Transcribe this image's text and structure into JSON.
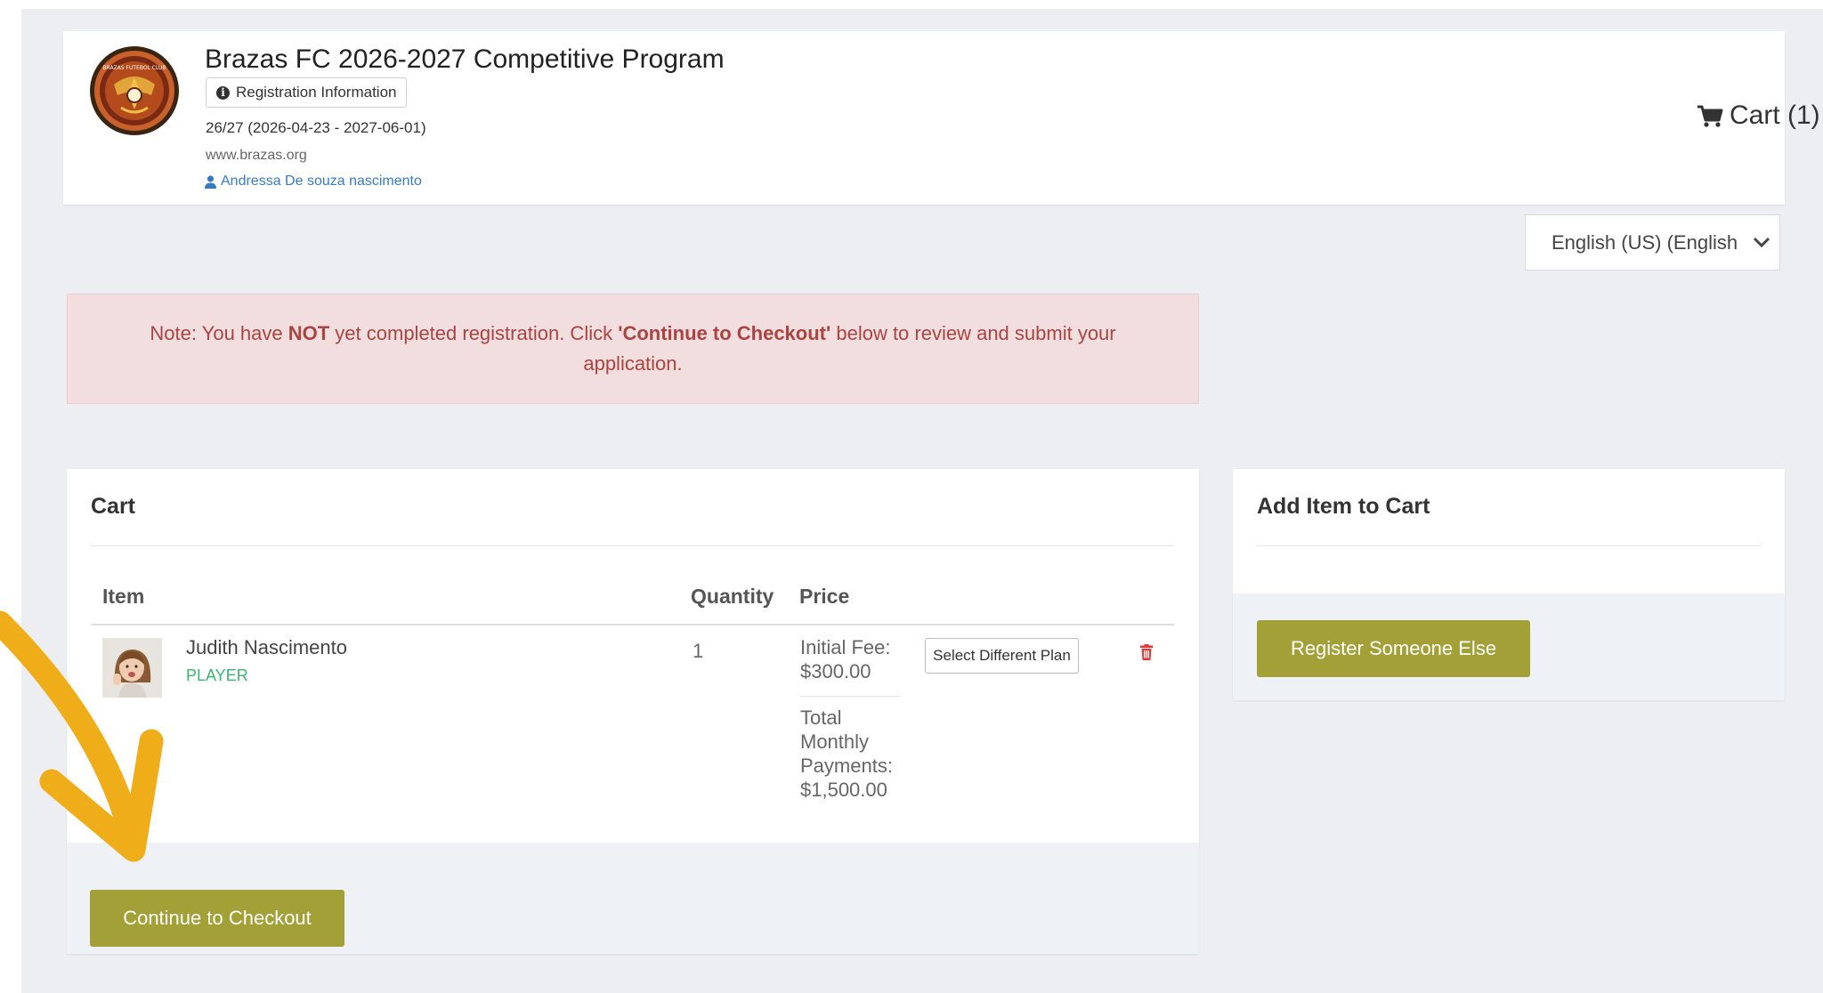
{
  "header": {
    "title": "Brazas FC 2026-2027 Competitive Program",
    "registration_info_label": "Registration Information",
    "season": "26/27 (2026-04-23 - 2027-06-01)",
    "website": "www.brazas.org",
    "user_name": "Andressa De souza nascimento",
    "cart_label": "Cart (1)",
    "logo_text": "BRAZAS FUTEBOL CLUB"
  },
  "language": {
    "selected": "English (US) (English"
  },
  "note": {
    "prefix": "Note: You have ",
    "emphasis": "NOT",
    "middle": " yet completed registration. Click ",
    "link": "'Continue to Checkout'",
    "suffix": " below to review and submit your application."
  },
  "cart": {
    "title": "Cart",
    "columns": {
      "item": "Item",
      "quantity": "Quantity",
      "price": "Price"
    },
    "items": [
      {
        "name": "Judith Nascimento",
        "role": "PLAYER",
        "quantity": "1",
        "initial_fee_label": "Initial Fee:",
        "initial_fee": "$300.00",
        "monthly_label": "Total Monthly Payments:",
        "monthly_total": "$1,500.00",
        "plan_button": "Select Different Plan"
      }
    ],
    "checkout_button": "Continue to Checkout"
  },
  "add_item": {
    "title": "Add Item to Cart",
    "register_button": "Register Someone Else"
  },
  "colors": {
    "olive_button": "#a3a038",
    "alert_bg": "#f2dede",
    "alert_text": "#a94442",
    "player_role": "#3cb371",
    "link_blue": "#3a7bc0",
    "annotation_arrow": "#f0ad1a",
    "trash": "#e03a3a"
  },
  "icons": {
    "info": "info-circle-icon",
    "user": "user-icon",
    "cart": "shopping-cart-icon",
    "chevron": "chevron-down-icon",
    "trash": "trash-icon",
    "annotation": "annotation-arrow-icon"
  }
}
